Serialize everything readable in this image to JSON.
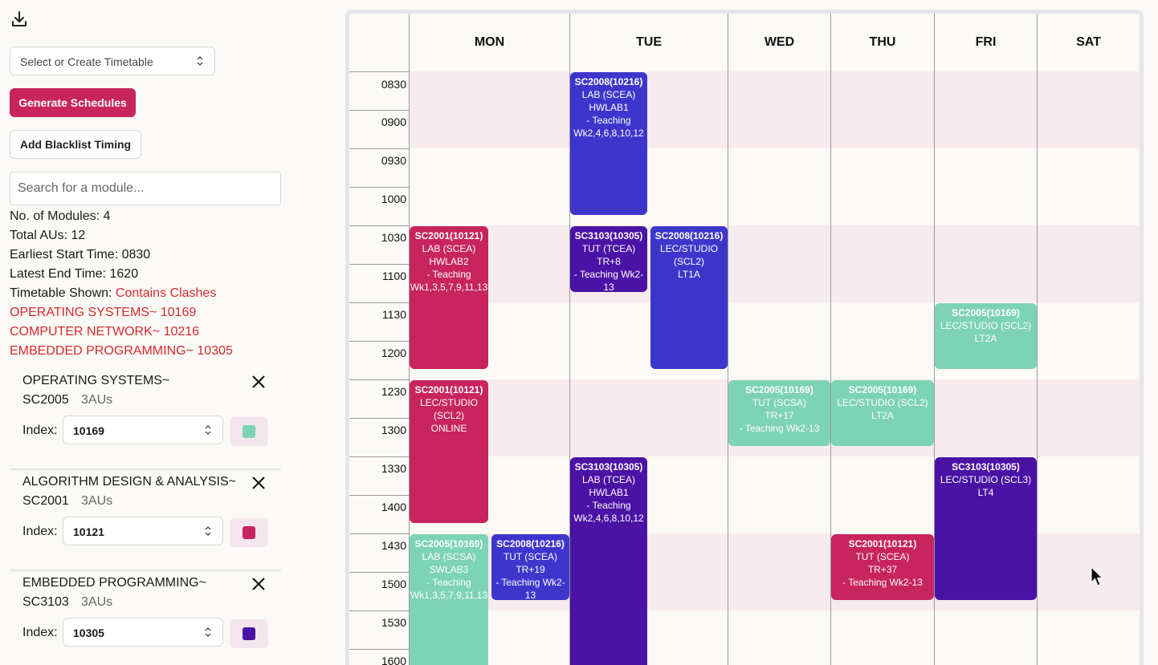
{
  "sidebar": {
    "timetable_select": "Select or Create Timetable",
    "generate_label": "Generate Schedules",
    "blacklist_label": "Add Blacklist Timing",
    "search_placeholder": "Search for a module...",
    "stats": {
      "modules": "No. of Modules: 4",
      "aus": "Total AUs: 12",
      "earliest": "Earliest Start Time: 0830",
      "latest": "Latest End Time: 1620",
      "shown_label": "Timetable Shown: ",
      "shown_value": "Contains Clashes"
    },
    "clashes": [
      "OPERATING SYSTEMS~ 10169",
      "COMPUTER NETWORK~ 10216",
      "EMBEDDED PROGRAMMING~ 10305"
    ],
    "modules": [
      {
        "name": "OPERATING SYSTEMS~",
        "code": "SC2005",
        "au": "3AUs",
        "index_label": "Index:",
        "index": "10169",
        "color": "#7dd3b5"
      },
      {
        "name": "ALGORITHM DESIGN & ANALYSIS~",
        "code": "SC2001",
        "au": "3AUs",
        "index_label": "Index:",
        "index": "10121",
        "color": "#c8245e"
      },
      {
        "name": "EMBEDDED PROGRAMMING~",
        "code": "SC3103",
        "au": "3AUs",
        "index_label": "Index:",
        "index": "10305",
        "color": "#4b12a6"
      }
    ]
  },
  "timetable": {
    "days": [
      "MON",
      "TUE",
      "WED",
      "THU",
      "FRI",
      "SAT"
    ],
    "times": [
      "0830",
      "0900",
      "0930",
      "1000",
      "1030",
      "1100",
      "1130",
      "1200",
      "1230",
      "1300",
      "1330",
      "1400",
      "1430",
      "1500",
      "1530",
      "1600"
    ],
    "events": [
      {
        "code": "SC2008(10216)",
        "text": "LAB (SCEA)\nHWLAB1\n- Teaching Wk2,4,6,8,10,12",
        "color": "#3e36cc"
      },
      {
        "code": "SC2001(10121)",
        "text": "LAB (SCEA)\nHWLAB2\n- Teaching Wk1,3,5,7,9,11,13",
        "color": "#c8245e"
      },
      {
        "code": "SC3103(10305)",
        "text": "TUT (TCEA)\nTR+8\n- Teaching Wk2-13",
        "color": "#4b12a6"
      },
      {
        "code": "SC2008(10216)",
        "text": "LEC/STUDIO (SCL2)\nLT1A",
        "color": "#3e36cc"
      },
      {
        "code": "SC2005(10169)",
        "text": "LEC/STUDIO (SCL2)\nLT2A",
        "color": "#7dd3b5"
      },
      {
        "code": "SC2001(10121)",
        "text": "LEC/STUDIO (SCL2)\nONLINE",
        "color": "#c8245e"
      },
      {
        "code": "SC2005(10169)",
        "text": "TUT (SCSA)\nTR+17\n- Teaching Wk2-13",
        "color": "#7dd3b5"
      },
      {
        "code": "SC2005(10169)",
        "text": "LEC/STUDIO (SCL2)\nLT2A",
        "color": "#7dd3b5"
      },
      {
        "code": "SC3103(10305)",
        "text": "LAB (TCEA)\nHWLAB1\n- Teaching Wk2,4,6,8,10,12",
        "color": "#4b12a6"
      },
      {
        "code": "SC3103(10305)",
        "text": "LEC/STUDIO (SCL3)\nLT4",
        "color": "#4b12a6"
      },
      {
        "code": "SC2005(10169)",
        "text": "LAB (SCSA)\nSWLAB3\n- Teaching Wk1,3,5,7,9,11,13",
        "color": "#7dd3b5"
      },
      {
        "code": "SC2008(10216)",
        "text": "TUT (SCEA)\nTR+19\n- Teaching Wk2-13",
        "color": "#3e36cc"
      },
      {
        "code": "SC2001(10121)",
        "text": "TUT (SCEA)\nTR+37\n- Teaching Wk2-13",
        "color": "#c8245e"
      }
    ]
  }
}
